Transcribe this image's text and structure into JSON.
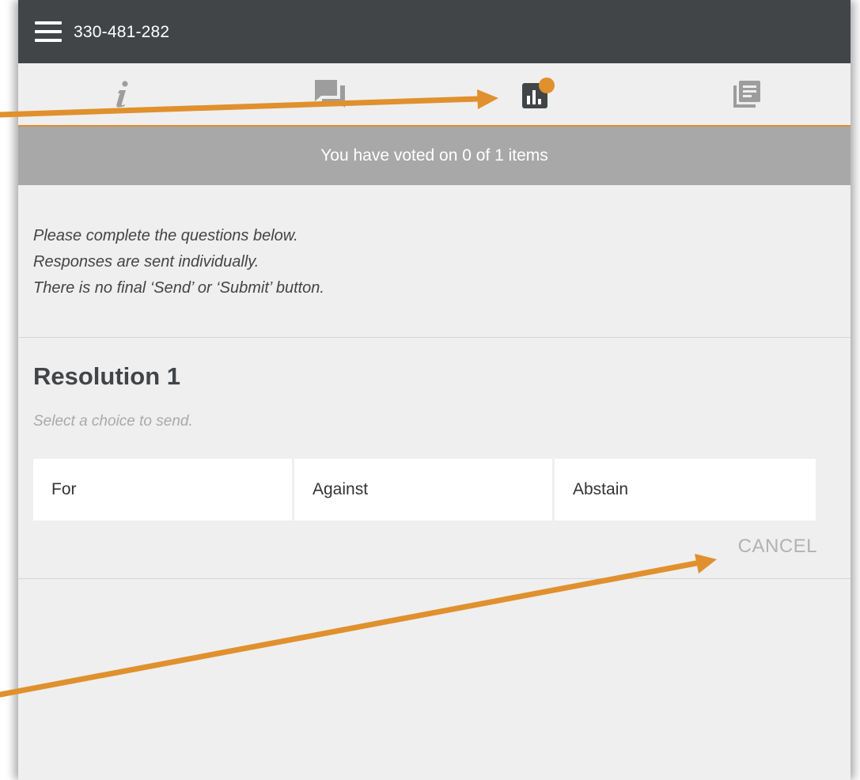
{
  "header": {
    "meeting_id": "330-481-282",
    "menu_icon": "hamburger-menu-icon"
  },
  "tabs": [
    {
      "name": "info",
      "icon": "info-icon",
      "active": false
    },
    {
      "name": "messages",
      "icon": "chat-icon",
      "active": false
    },
    {
      "name": "polls",
      "icon": "bar-chart-icon",
      "active": true,
      "notification": true
    },
    {
      "name": "documents",
      "icon": "document-icon",
      "active": false
    }
  ],
  "status": {
    "text": "You have voted on 0 of 1 items"
  },
  "instructions": {
    "line1": "Please complete the questions below.",
    "line2": "Responses are sent individually.",
    "line3": "There is no final ‘Send’ or ‘Submit’ button."
  },
  "resolution": {
    "title": "Resolution 1",
    "hint": "Select a choice to send.",
    "choices": [
      "For",
      "Against",
      "Abstain"
    ],
    "cancel_label": "CANCEL"
  },
  "colors": {
    "topbar": "#414547",
    "accent": "#e0902d",
    "status_bar": "#a8a8a8",
    "background": "#efefef"
  }
}
